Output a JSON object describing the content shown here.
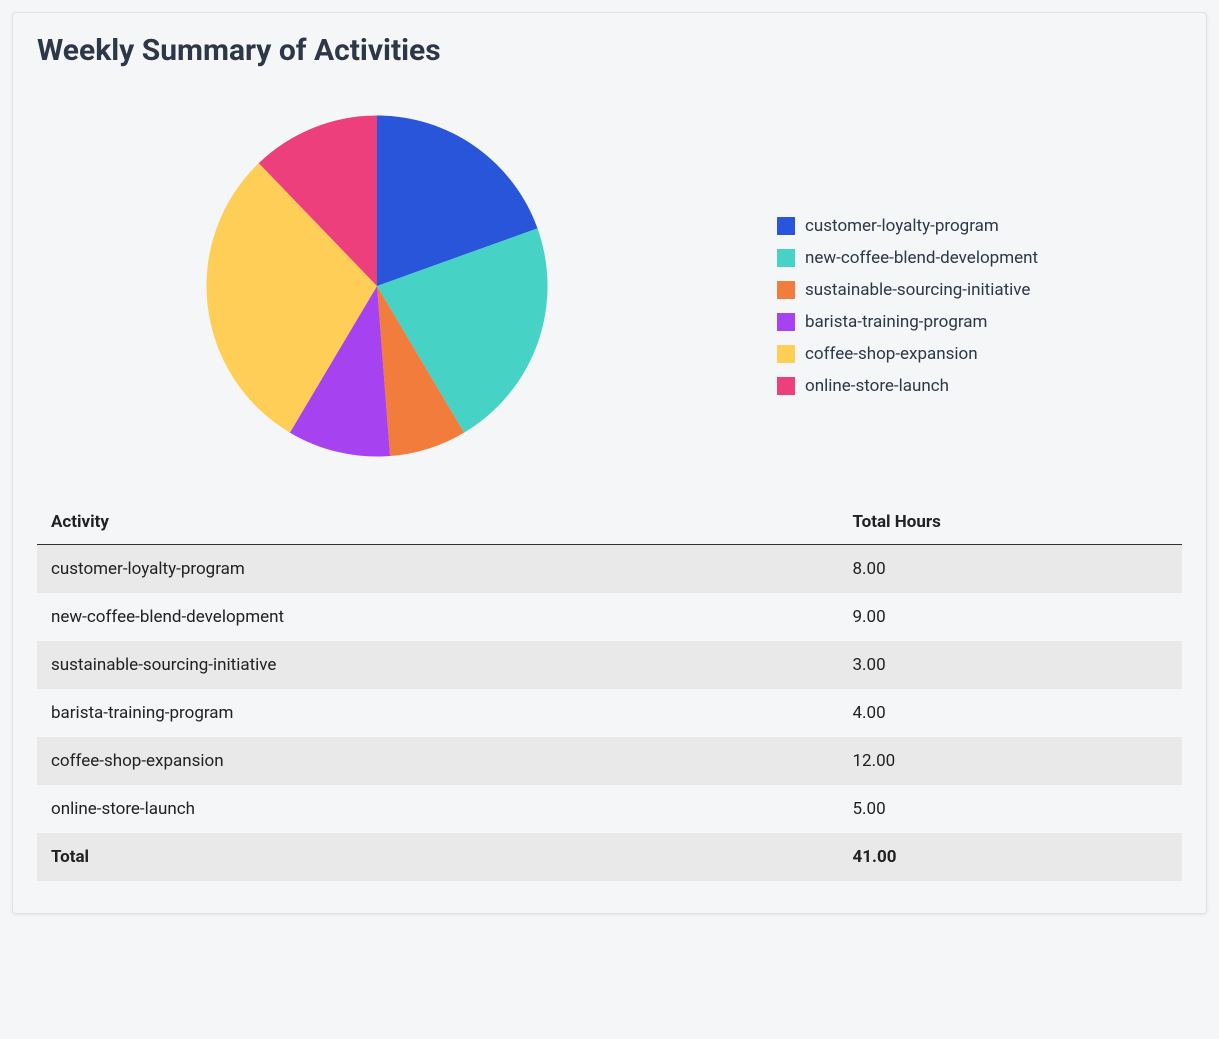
{
  "card": {
    "title": "Weekly Summary of Activities"
  },
  "table": {
    "headers": {
      "activity": "Activity",
      "hours": "Total Hours"
    },
    "rows": [
      {
        "activity": "customer-loyalty-program",
        "hours": "8.00"
      },
      {
        "activity": "new-coffee-blend-development",
        "hours": "9.00"
      },
      {
        "activity": "sustainable-sourcing-initiative",
        "hours": "3.00"
      },
      {
        "activity": "barista-training-program",
        "hours": "4.00"
      },
      {
        "activity": "coffee-shop-expansion",
        "hours": "12.00"
      },
      {
        "activity": "online-store-launch",
        "hours": "5.00"
      }
    ],
    "total": {
      "label": "Total",
      "hours": "41.00"
    }
  },
  "chart_data": {
    "type": "pie",
    "title": "Weekly Summary of Activities",
    "categories": [
      "customer-loyalty-program",
      "new-coffee-blend-development",
      "sustainable-sourcing-initiative",
      "barista-training-program",
      "coffee-shop-expansion",
      "online-store-launch"
    ],
    "values": [
      8,
      9,
      3,
      4,
      12,
      5
    ],
    "colors": [
      "#2955da",
      "#46d2c4",
      "#f27c3b",
      "#a742f0",
      "#ffce56",
      "#ed3f7c"
    ]
  }
}
